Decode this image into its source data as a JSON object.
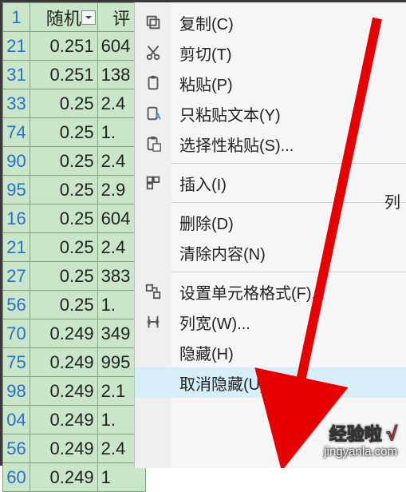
{
  "sheet": {
    "headers": [
      "随机",
      "评"
    ],
    "rows": [
      {
        "n": "1",
        "a": "",
        "b": ""
      },
      {
        "n": "21",
        "a": "0.251",
        "b": "604"
      },
      {
        "n": "31",
        "a": "0.251",
        "b": "138"
      },
      {
        "n": "33",
        "a": "0.25",
        "b": "2.4"
      },
      {
        "n": "74",
        "a": "0.25",
        "b": "1."
      },
      {
        "n": "90",
        "a": "0.25",
        "b": "2.4"
      },
      {
        "n": "95",
        "a": "0.25",
        "b": "2.9"
      },
      {
        "n": "16",
        "a": "0.25",
        "b": "604"
      },
      {
        "n": "21",
        "a": "0.25",
        "b": "2.4"
      },
      {
        "n": "27",
        "a": "0.25",
        "b": "383"
      },
      {
        "n": "56",
        "a": "0.25",
        "b": "1."
      },
      {
        "n": "70",
        "a": "0.249",
        "b": "349"
      },
      {
        "n": "75",
        "a": "0.249",
        "b": "995"
      },
      {
        "n": "98",
        "a": "0.249",
        "b": "2.1"
      },
      {
        "n": "04",
        "a": "0.249",
        "b": "1."
      },
      {
        "n": "56",
        "a": "0.249",
        "b": "2.4"
      },
      {
        "n": "60",
        "a": "0.249",
        "b": "1"
      }
    ]
  },
  "menu": {
    "items": [
      {
        "icon": "copy-icon",
        "label": "复制(C)"
      },
      {
        "icon": "cut-icon",
        "label": "剪切(T)"
      },
      {
        "icon": "paste-icon",
        "label": "粘贴(P)"
      },
      {
        "icon": "paste-text-icon",
        "label": "只粘贴文本(Y)"
      },
      {
        "icon": "paste-special-icon",
        "label": "选择性粘贴(S)..."
      },
      {
        "sep": true
      },
      {
        "icon": "insert-icon",
        "label": "插入(I)"
      },
      {
        "sep": true
      },
      {
        "icon": "",
        "label": "删除(D)"
      },
      {
        "icon": "",
        "label": "清除内容(N)"
      },
      {
        "sep": true
      },
      {
        "icon": "format-cells-icon",
        "label": "设置单元格格式(F)..."
      },
      {
        "icon": "col-width-icon",
        "label": "列宽(W)..."
      },
      {
        "icon": "",
        "label": "隐藏(H)"
      },
      {
        "icon": "",
        "label": "取消隐藏(U)",
        "hover": true
      }
    ],
    "right_label": "列"
  },
  "watermark": {
    "line1": "经验啦",
    "check": "√",
    "line2": "jingyanla.com"
  }
}
